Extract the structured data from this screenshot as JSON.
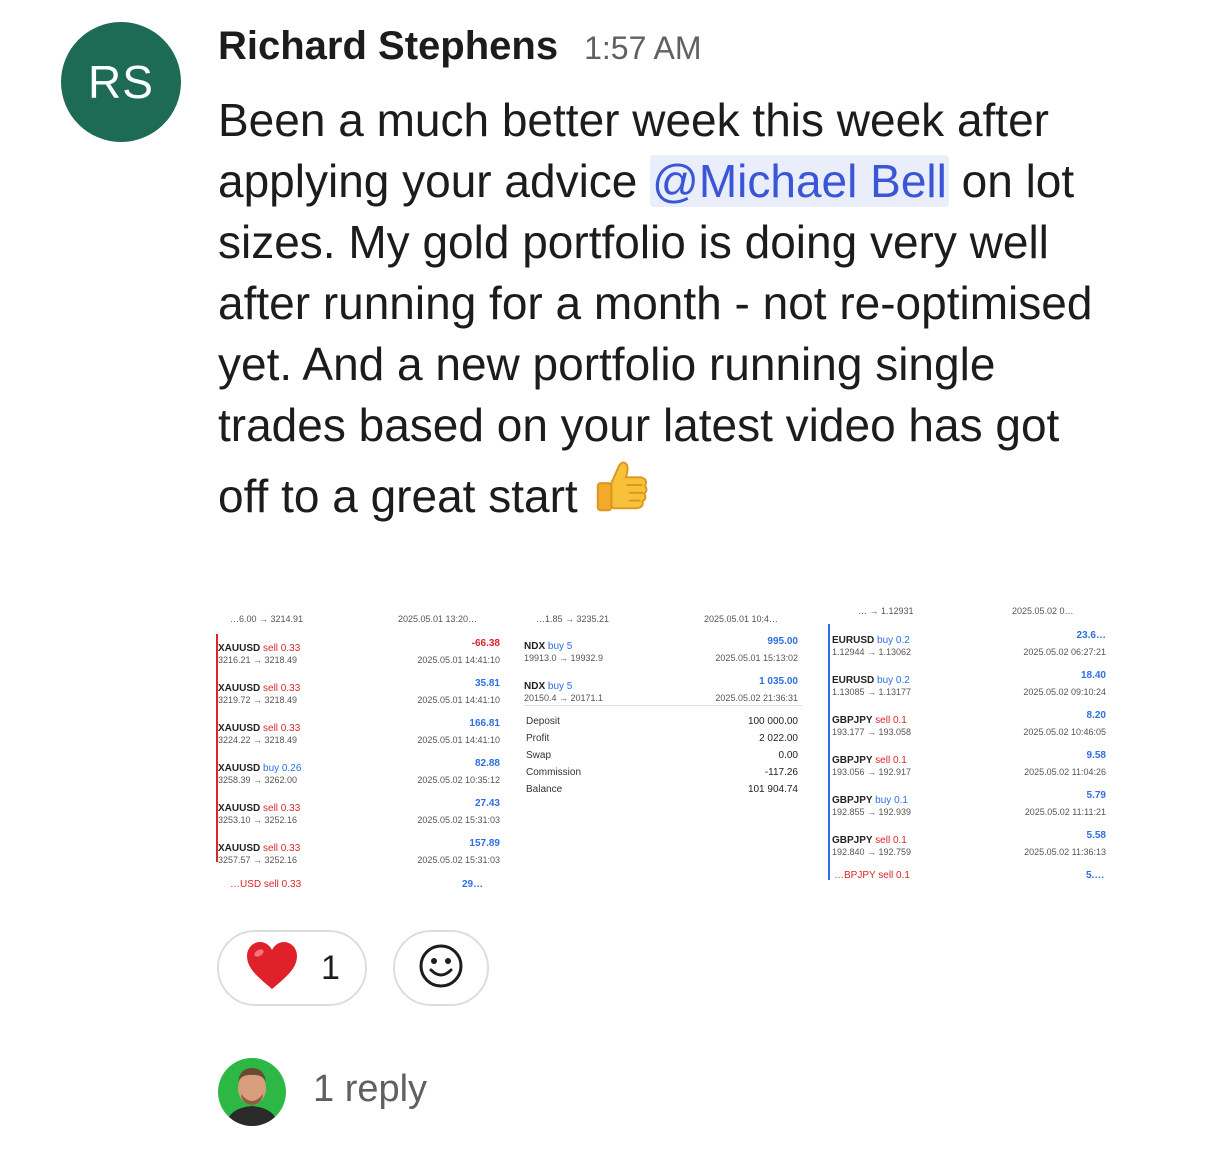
{
  "author": {
    "initials": "RS",
    "name": "Richard Stephens",
    "time": "1:57 AM",
    "avatar_color": "#1d6b55"
  },
  "message": {
    "part1": "Been a much better week this week after applying your advice ",
    "mention": "@Michael Bell",
    "part2": " on lot sizes. My gold portfolio is doing very well after running for a month - not re-optimised yet. And a new portfolio running single trades based on your latest video has got off to a great start ",
    "emoji": "thumbs-up-icon"
  },
  "screenshots": {
    "left": {
      "top_price": "…6.00 → 3214.91",
      "top_time": "2025.05.01 13:20…",
      "trades": [
        {
          "symbol": "XAUUSD",
          "side": "sell",
          "lots": "0.33",
          "prices": "3216.21 → 3218.49",
          "profit": "-66.38",
          "time": "2025.05.01 14:41:10"
        },
        {
          "symbol": "XAUUSD",
          "side": "sell",
          "lots": "0.33",
          "prices": "3219.72 → 3218.49",
          "profit": "35.81",
          "time": "2025.05.01 14:41:10"
        },
        {
          "symbol": "XAUUSD",
          "side": "sell",
          "lots": "0.33",
          "prices": "3224.22 → 3218.49",
          "profit": "166.81",
          "time": "2025.05.01 14:41:10"
        },
        {
          "symbol": "XAUUSD",
          "side": "buy",
          "lots": "0.26",
          "prices": "3258.39 → 3262.00",
          "profit": "82.88",
          "time": "2025.05.02 10:35:12"
        },
        {
          "symbol": "XAUUSD",
          "side": "sell",
          "lots": "0.33",
          "prices": "3253.10 → 3252.16",
          "profit": "27.43",
          "time": "2025.05.02 15:31:03"
        },
        {
          "symbol": "XAUUSD",
          "side": "sell",
          "lots": "0.33",
          "prices": "3257.57 → 3252.16",
          "profit": "157.89",
          "time": "2025.05.02 15:31:03"
        }
      ],
      "bottom_symbol": "…USD sell 0.33",
      "bottom_profit": "29…"
    },
    "middle": {
      "top_price": "…1.85 → 3235.21",
      "top_time": "2025.05.01 10:4…",
      "trades": [
        {
          "symbol": "NDX",
          "side": "buy",
          "lots": "5",
          "prices": "19913.0 → 19932.9",
          "profit": "995.00",
          "time": "2025.05.01 15:13:02"
        },
        {
          "symbol": "NDX",
          "side": "buy",
          "lots": "5",
          "prices": "20150.4 → 20171.1",
          "profit": "1 035.00",
          "time": "2025.05.02 21:36:31"
        }
      ],
      "summary": [
        {
          "label": "Deposit",
          "value": "100 000.00"
        },
        {
          "label": "Profit",
          "value": "2 022.00"
        },
        {
          "label": "Swap",
          "value": "0.00"
        },
        {
          "label": "Commission",
          "value": "-117.26"
        },
        {
          "label": "Balance",
          "value": "101 904.74"
        }
      ]
    },
    "right": {
      "top_price": "… → 1.12931",
      "top_time": "2025.05.02 0…",
      "trades": [
        {
          "symbol": "EURUSD",
          "side": "buy",
          "lots": "0.2",
          "prices": "1.12944 → 1.13062",
          "profit": "23.6…",
          "time": "2025.05.02 06:27:21"
        },
        {
          "symbol": "EURUSD",
          "side": "buy",
          "lots": "0.2",
          "prices": "1.13085 → 1.13177",
          "profit": "18.40",
          "time": "2025.05.02 09:10:24"
        },
        {
          "symbol": "GBPJPY",
          "side": "sell",
          "lots": "0.1",
          "prices": "193.177 → 193.058",
          "profit": "8.20",
          "time": "2025.05.02 10:46:05"
        },
        {
          "symbol": "GBPJPY",
          "side": "sell",
          "lots": "0.1",
          "prices": "193.056 → 192.917",
          "profit": "9.58",
          "time": "2025.05.02 11:04:26"
        },
        {
          "symbol": "GBPJPY",
          "side": "buy",
          "lots": "0.1",
          "prices": "192.855 → 192.939",
          "profit": "5.79",
          "time": "2025.05.02 11:11:21"
        },
        {
          "symbol": "GBPJPY",
          "side": "sell",
          "lots": "0.1",
          "prices": "192.840 → 192.759",
          "profit": "5.58",
          "time": "2025.05.02 11:36:13"
        }
      ],
      "bottom_symbol": "…BPJPY sell 0.1",
      "bottom_profit": "5.…"
    }
  },
  "reactions": [
    {
      "emoji": "heart-icon",
      "count": "1",
      "color": "#e0202b"
    }
  ],
  "add_reaction": "add-reaction-icon",
  "replies": {
    "text": "1 reply",
    "avatar_bg": "#2db845"
  }
}
